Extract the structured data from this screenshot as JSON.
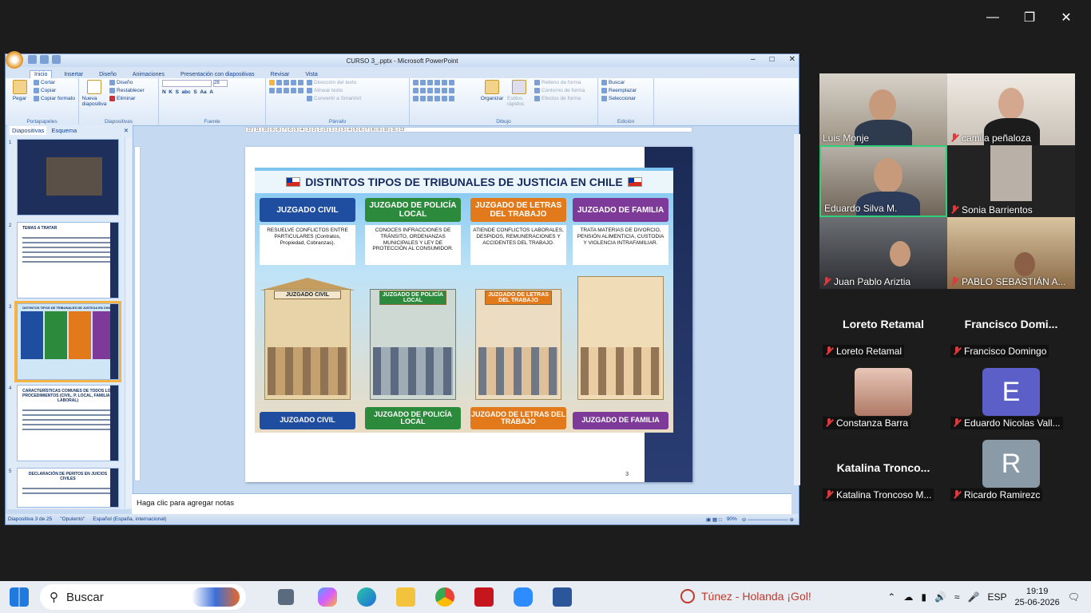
{
  "ppt": {
    "title": "CURSO 3_.pptx - Microsoft PowerPoint",
    "tabs": [
      "Inicio",
      "Insertar",
      "Diseño",
      "Animaciones",
      "Presentación con diapositivas",
      "Revisar",
      "Vista"
    ],
    "ribbon": {
      "paste": "Pegar",
      "cut": "Cortar",
      "copy": "Copiar",
      "format_painter": "Copiar formato",
      "clipboard_label": "Portapapeles",
      "new_slide": "Nueva diapositiva",
      "design": "Diseño",
      "reset": "Restablecer",
      "delete": "Eliminar",
      "slides_label": "Diapositivas",
      "font_label": "Fuente",
      "font_size": "28",
      "text_direction": "Dirección del texto",
      "align_text": "Alinear texto",
      "smartart": "Convertir a SmartArt",
      "paragraph_label": "Párrafo",
      "arrange": "Organizar",
      "quick_styles": "Estilos rápidos",
      "shape_fill": "Relleno de forma",
      "shape_outline": "Contorno de forma",
      "shape_effects": "Efectos de forma",
      "drawing_label": "Dibujo",
      "find": "Buscar",
      "replace": "Reemplazar",
      "select": "Seleccionar",
      "editing_label": "Edición"
    },
    "left_tabs": [
      "Diapositivas",
      "Esquema"
    ],
    "thumbs": {
      "t2_title": "TEMAS A TRATAR",
      "t3_title": "DISTINTOS TIPOS DE TRIBUNALES DE JUSTICIA EN CHILE",
      "t4_title": "CARACTERÍSTICAS COMUNES DE TODOS LOS PROCEDIMIENTOS (CIVIL, P. LOCAL, FAMILIA Y LABORAL)",
      "t5_title": "DECLARACIÓN DE PERITOS EN JUICIOS CIVILES",
      "numbers": [
        "1",
        "2",
        "3",
        "4",
        "5"
      ]
    },
    "slide": {
      "title": "DISTINTOS TIPOS DE TRIBUNALES DE JUSTICIA EN CHILE",
      "number": "3",
      "columns": [
        {
          "head": "JUZGADO CIVIL",
          "desc": "RESUELVE CONFLICTOS ENTRE PARTICULARES (Contratos, Propiedad, Cobranzas).",
          "sign": "JUZGADO CIVIL",
          "foot": "JUZGADO CIVIL"
        },
        {
          "head": "JUZGADO DE POLICÍA LOCAL",
          "desc": "CONOCES INFRACCIONES DE TRÁNSITO, ORDENANZAS MUNICIPALES Y LEY DE PROTECCIÓN AL CONSUMIDOR.",
          "sign": "JUZGADO DE POLICÍA LOCAL",
          "foot": "JUZGADO DE POLICÍA LOCAL"
        },
        {
          "head": "JUZGADO DE LETRAS DEL TRABAJO",
          "desc": "ATIENDE CONFLICTOS LABORALES, DESPIDOS, REMUNERACIONES Y ACCIDENTES DEL TRABAJO.",
          "sign": "JUZGADO DE LETRAS DEL TRABAJO",
          "foot": "JUZGADO DE LETRAS DEL TRABAJO"
        },
        {
          "head": "JUZGADO DE FAMILIA",
          "desc": "TRATA MATERIAS DE DIVORCIO, PENSIÓN ALIMENTICIA, CUSTODIA Y VIOLENCIA INTRAFAMILIAR.",
          "sign": "",
          "foot": "JUZGADO DE FAMILIA"
        }
      ]
    },
    "notes_placeholder": "Haga clic para agregar notas",
    "status": {
      "slide_of": "Diapositiva 3 de 25",
      "theme": "\"Opulento\"",
      "language": "Español (España, internacional)",
      "zoom": "90%"
    }
  },
  "zoom": {
    "participants_video": [
      {
        "name": "Luis Monje",
        "muted": false
      },
      {
        "name": "camila peñaloza",
        "muted": true
      },
      {
        "name": "Eduardo Silva M.",
        "muted": false
      },
      {
        "name": "Sonia Barrientos",
        "muted": true
      },
      {
        "name": "Juan Pablo Ariztia",
        "muted": true
      },
      {
        "name": "PABLO SEBASTIÁN A...",
        "muted": true
      }
    ],
    "participants_other": [
      {
        "big": "Loreto Retamal",
        "name": "Loreto Retamal"
      },
      {
        "big": "Francisco  Domi...",
        "name": "Francisco Domingo"
      },
      {
        "big": "",
        "name": "Constanza Barra"
      },
      {
        "big": "",
        "name": "Eduardo Nicolas Vall...",
        "avatar": "E"
      },
      {
        "big": "Katalina  Tronco...",
        "name": "Katalina Troncoso M..."
      },
      {
        "big": "",
        "name": "Ricardo Ramirezc",
        "avatar": "R"
      }
    ]
  },
  "taskbar": {
    "search": "Buscar",
    "news": "Túnez - Holanda ¡Gol!",
    "lang": "ESP",
    "time": "19:19",
    "date": "25-06-2026"
  },
  "colors": {
    "accent_green": "#2fd07a",
    "avatar_e": "#5b5fc7",
    "avatar_r": "#8a9aa6"
  }
}
